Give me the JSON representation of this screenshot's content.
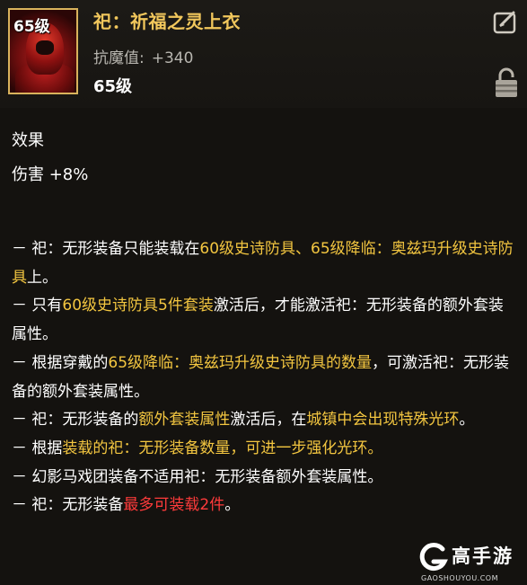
{
  "item": {
    "level_badge": "65级",
    "title": "祀：祈福之灵上衣",
    "stat_label": "抗魔值:",
    "stat_value": "+340",
    "level": "65级"
  },
  "effect": {
    "heading": "效果",
    "value": "伤害 +8%"
  },
  "lines": {
    "l1_a": "－ 祀：无形装备只能装载在",
    "l1_b": "60级史诗防具、65级降临：奥兹玛升级史诗防具",
    "l1_c": "上。",
    "l2_a": "－ 只有",
    "l2_b": "60级史诗防具5件套装",
    "l2_c": "激活后，才能激活祀：无形装备的额外套装属性。",
    "l3_a": "－ 根据穿戴的",
    "l3_b": "65级降临：奥兹玛升级史诗防具的数量",
    "l3_c": "，可激活祀：无形装备的额外套装属性。",
    "l4_a": "－ 祀：无形装备的",
    "l4_b": "额外套装属性",
    "l4_c": "激活后，在",
    "l4_d": "城镇中会出现特殊光环",
    "l4_e": "。",
    "l5_a": "－ 根据",
    "l5_b": "装载的祀：无形装备数量，可进一步强化光环。",
    "l6": "－ 幻影马戏团装备不适用祀：无形装备额外套装属性。",
    "l7_a": "－ 祀：无形装备",
    "l7_b": "最多可装载2件",
    "l7_c": "。"
  },
  "watermark": {
    "name": "高手游",
    "domain": "GAOSHOUYOU.COM"
  },
  "icons": [
    "edit-icon",
    "lock-icon",
    "item-armor-icon",
    "gaoshouyou-logo-icon"
  ],
  "colors": {
    "title": "#f1c75c",
    "highlight": "#f3c640",
    "red": "#ff3b3b",
    "frame": "#d9b35c"
  }
}
